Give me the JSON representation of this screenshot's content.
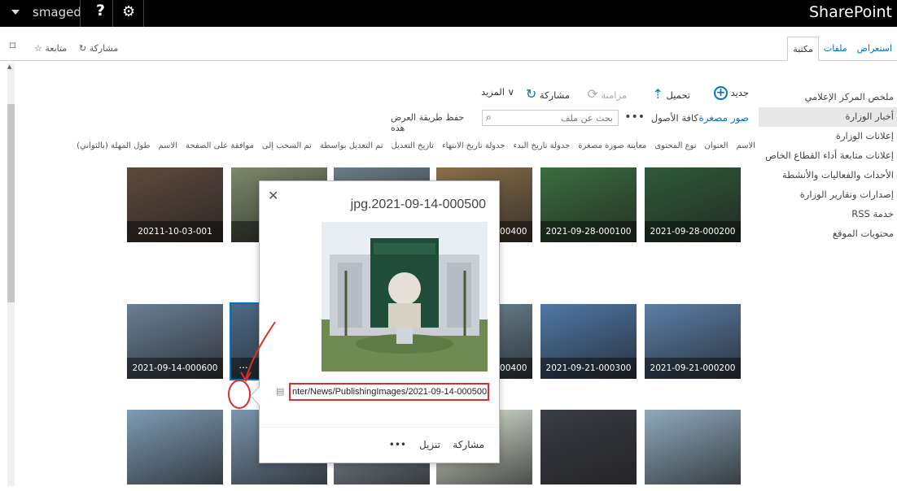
{
  "suite_bar": {
    "user_name": "smaged",
    "help_symbol": "?",
    "brand": "SharePoint"
  },
  "ribbon": {
    "share_label": "مشاركة",
    "follow_label": "متابعة",
    "tabs": [
      {
        "label": "استعراض",
        "active": false
      },
      {
        "label": "ملفات",
        "active": false
      },
      {
        "label": "مكتبة",
        "active": true
      }
    ]
  },
  "quick_launch": [
    {
      "label": "ملخص المركز الإعلامي",
      "selected": false
    },
    {
      "label": "أخبار الوزارة",
      "selected": true
    },
    {
      "label": "إعلانات الوزارة",
      "selected": false
    },
    {
      "label": "إعلانات متابعة أداء القطاع الخاص",
      "selected": false
    },
    {
      "label": "الأحداث والفعاليات والأنشطة",
      "selected": false
    },
    {
      "label": "إصدارات وتقارير الوزارة",
      "selected": false
    },
    {
      "label": "خدمة RSS",
      "selected": false
    },
    {
      "label": "محتويات الموقع",
      "selected": false
    }
  ],
  "toolbar": {
    "new_label": "جديد",
    "upload_label": "تحميل",
    "sync_label": "مزامنة",
    "share_label": "مشاركة",
    "more_label": "المزيد ∨"
  },
  "views": {
    "active_view": "صور مصغرة",
    "all_assets": "كافة الأصول",
    "more_dots": "•••",
    "search_placeholder": "بحث عن ملف",
    "save_view": "حفظ طريقة العرض هذه"
  },
  "column_headers": [
    "الاسم",
    "العنوان",
    "نوع المحتوى",
    "معاينة صورة مصغرة",
    "جدولة تاريخ البدء",
    "جدولة تاريخ الانتهاء",
    "تاريخ التعديل",
    "تم التعديل بواسطة",
    "تم السحب إلى",
    "موافقة على الصفحة",
    "الاسم",
    "طول المهلة (بالثواني)"
  ],
  "tiles": [
    {
      "caption": "2021-09-28-000200",
      "tone": "#2f5a3a"
    },
    {
      "caption": "2021-09-28-000100",
      "tone": "#3b6e3f"
    },
    {
      "caption": "2021-09-14-000400",
      "tone": "#8a6f4b"
    },
    {
      "caption": "",
      "tone": "#6a7d87"
    },
    {
      "caption": "",
      "tone": "#7b8a6a"
    },
    {
      "caption": "20211-10-03-001",
      "tone": "#5d4a3e"
    },
    {
      "caption": "2021-09-21-000200",
      "tone": "#5b7fa8"
    },
    {
      "caption": "2021-09-21-000300",
      "tone": "#4f78a6"
    },
    {
      "caption": "2021-09-14-000400",
      "tone": "#6f8899"
    },
    {
      "caption": "",
      "tone": "#8b8b8b"
    },
    {
      "caption": "202",
      "tone": "#4d6a86"
    },
    {
      "caption": "2021-09-14-000600",
      "tone": "#6a7f94"
    },
    {
      "caption": "",
      "tone": "#8faabc"
    },
    {
      "caption": "",
      "tone": "#3a3c44"
    },
    {
      "caption": "",
      "tone": "#dfe7d8"
    },
    {
      "caption": "",
      "tone": "#8c9aa6"
    },
    {
      "caption": "",
      "tone": "#7a95ad"
    },
    {
      "caption": "",
      "tone": "#7e9cb5"
    }
  ],
  "selected_tile_ellipsis": "...",
  "callout": {
    "title": "jpg.2021-09-14-000500",
    "close_symbol": "✕",
    "url": "nter/News/PublishingImages/2021-09-14-000500.jpg",
    "share_label": "مشاركة",
    "download_label": "تنزيل",
    "more_dots": "•••"
  },
  "colors": {
    "accent": "#0072c6",
    "annotation_red": "#d9302a"
  }
}
